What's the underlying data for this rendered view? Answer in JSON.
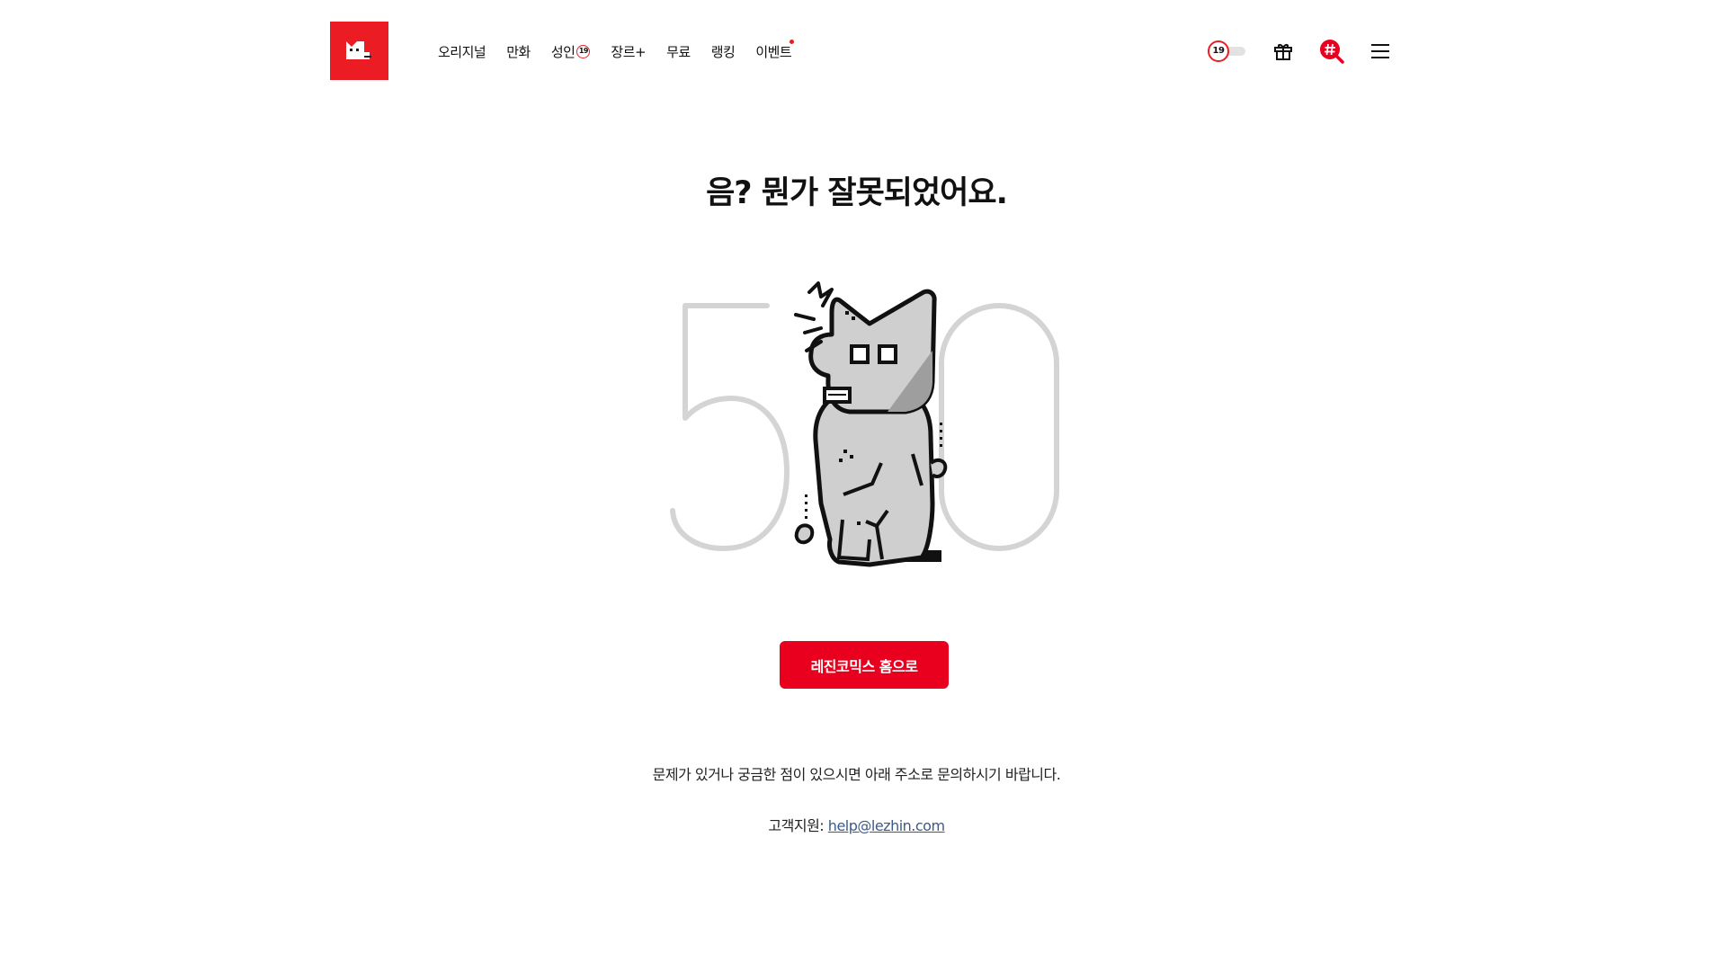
{
  "header": {
    "logo_alt": "Lezhin Comics",
    "nav": [
      {
        "label": "오리지널"
      },
      {
        "label": "만화"
      },
      {
        "label": "성인",
        "badge": "19"
      },
      {
        "label": "장르+"
      },
      {
        "label": "무료"
      },
      {
        "label": "랭킹"
      },
      {
        "label": "이벤트",
        "has_new": true
      }
    ],
    "adult_toggle": {
      "label": "19",
      "state": "off"
    },
    "icons": [
      "gift-icon",
      "hashtag-search-icon",
      "menu-icon"
    ]
  },
  "main": {
    "title": "음? 뭔가 잘못되었어요.",
    "illustration": "error-500-mascot",
    "home_button": "레진코믹스 홈으로",
    "notice": "문제가 있거나 궁금한 점이 있으시면 아래 주소로 문의하시기 바랍니다.",
    "support_label": "고객지원:",
    "support_email": "help@lezhin.com"
  },
  "colors": {
    "brand": "#ec1c24",
    "button": "#e8001e",
    "link": "#3b5a8a"
  }
}
